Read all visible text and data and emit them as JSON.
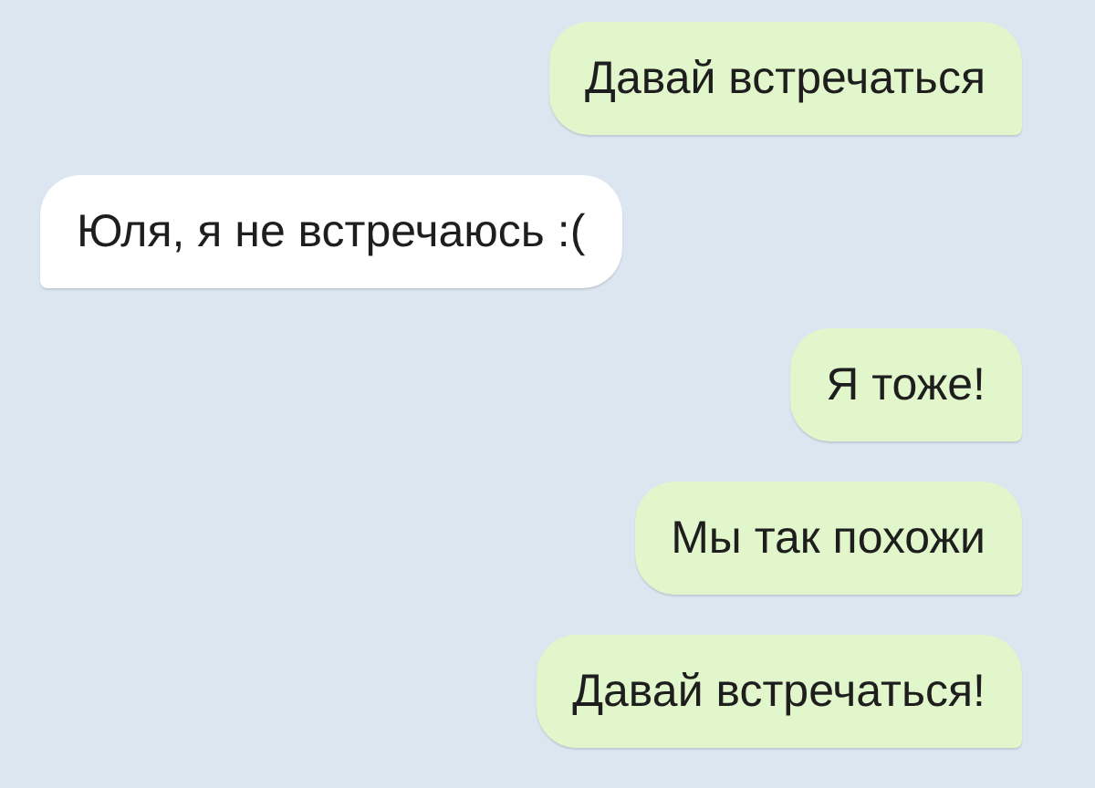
{
  "messages": [
    {
      "kind": "outgoing",
      "text": "Давай встречаться"
    },
    {
      "kind": "incoming",
      "text": "Юля, я не встречаюсь :("
    },
    {
      "kind": "outgoing",
      "text": "Я тоже!"
    },
    {
      "kind": "outgoing",
      "text": "Мы так похожи"
    },
    {
      "kind": "outgoing",
      "text": "Давай встречаться!"
    }
  ]
}
